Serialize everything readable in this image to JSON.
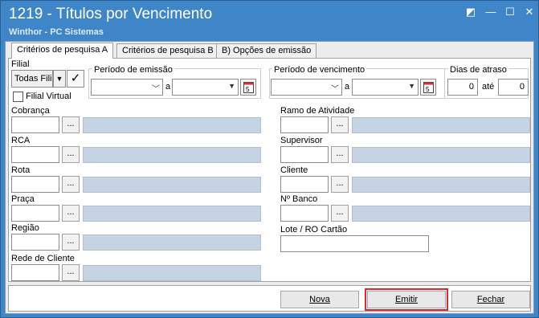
{
  "window": {
    "title": "1219 - Títulos por Vencimento",
    "subtitle": "Winthor - PC Sistemas",
    "controls": [
      "◩",
      "—",
      "☐",
      "✕"
    ]
  },
  "tabs": [
    {
      "label": "Critérios de pesquisa A",
      "active": true
    },
    {
      "label": "Critérios de pesquisa B",
      "active": false
    },
    {
      "label": "B) Opções de emissão",
      "active": false
    }
  ],
  "filial": {
    "label": "Filial",
    "select_value": "Todas Fili",
    "check_glyph": "✓",
    "virtual_label": "Filial Virtual"
  },
  "periodo_emissao": {
    "label": "Período de emissão",
    "sep": "a"
  },
  "periodo_vencimento": {
    "label": "Período de vencimento",
    "sep": "a"
  },
  "dias_atraso": {
    "label": "Dias de atraso",
    "from": "0",
    "sep": "até",
    "to": "0"
  },
  "left_fields": [
    {
      "label": "Cobrança"
    },
    {
      "label": "RCA"
    },
    {
      "label": "Rota"
    },
    {
      "label": "Praça"
    },
    {
      "label": "Região"
    },
    {
      "label": "Rede de Cliente"
    }
  ],
  "right_fields": [
    {
      "label": "Ramo de Atividade"
    },
    {
      "label": "Supervisor"
    },
    {
      "label": "Cliente"
    },
    {
      "label": "Nº Banco"
    }
  ],
  "lote": {
    "label": "Lote / RO Cartão"
  },
  "ellipsis": "...",
  "buttons": {
    "nova": "Nova",
    "emitir": "Emitir",
    "fechar": "Fechar"
  },
  "colors": {
    "titlebar": "#3f86c8",
    "readonly_field": "#c5d3e3",
    "highlight": "#e0282c"
  }
}
